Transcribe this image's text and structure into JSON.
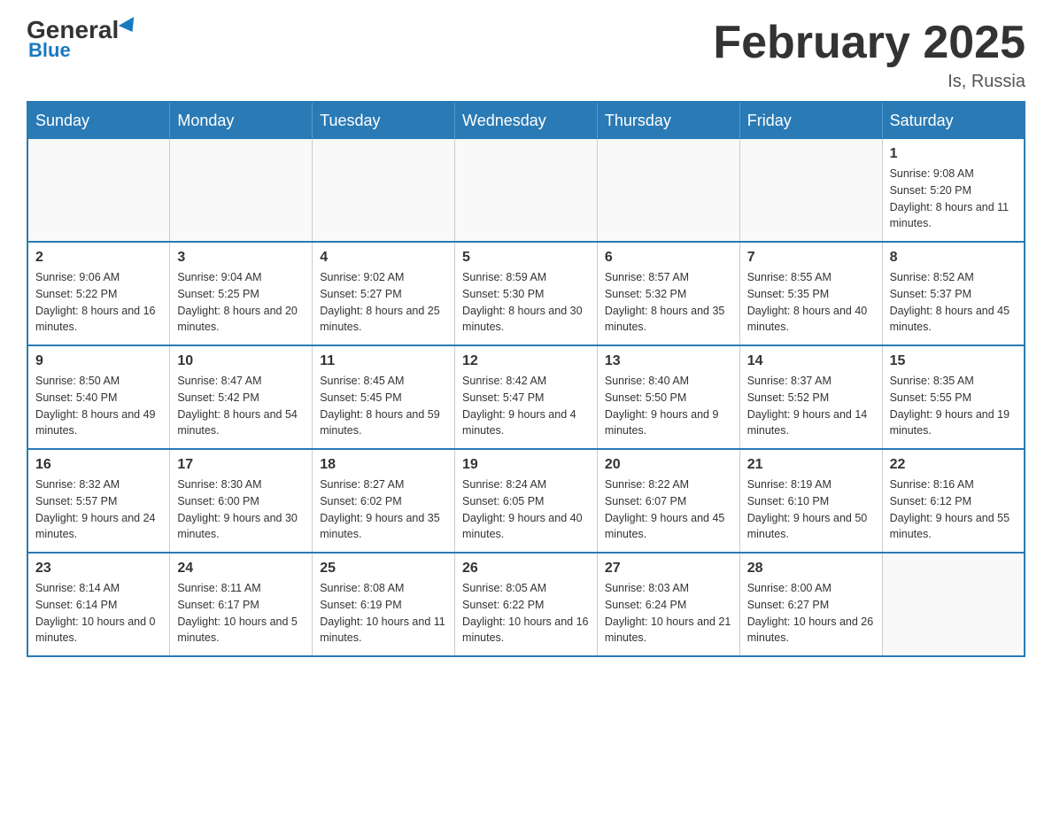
{
  "logo": {
    "general": "General",
    "blue": "Blue"
  },
  "title": "February 2025",
  "location": "Is, Russia",
  "weekdays": [
    "Sunday",
    "Monday",
    "Tuesday",
    "Wednesday",
    "Thursday",
    "Friday",
    "Saturday"
  ],
  "weeks": [
    [
      {
        "day": "",
        "info": ""
      },
      {
        "day": "",
        "info": ""
      },
      {
        "day": "",
        "info": ""
      },
      {
        "day": "",
        "info": ""
      },
      {
        "day": "",
        "info": ""
      },
      {
        "day": "",
        "info": ""
      },
      {
        "day": "1",
        "info": "Sunrise: 9:08 AM\nSunset: 5:20 PM\nDaylight: 8 hours and 11 minutes."
      }
    ],
    [
      {
        "day": "2",
        "info": "Sunrise: 9:06 AM\nSunset: 5:22 PM\nDaylight: 8 hours and 16 minutes."
      },
      {
        "day": "3",
        "info": "Sunrise: 9:04 AM\nSunset: 5:25 PM\nDaylight: 8 hours and 20 minutes."
      },
      {
        "day": "4",
        "info": "Sunrise: 9:02 AM\nSunset: 5:27 PM\nDaylight: 8 hours and 25 minutes."
      },
      {
        "day": "5",
        "info": "Sunrise: 8:59 AM\nSunset: 5:30 PM\nDaylight: 8 hours and 30 minutes."
      },
      {
        "day": "6",
        "info": "Sunrise: 8:57 AM\nSunset: 5:32 PM\nDaylight: 8 hours and 35 minutes."
      },
      {
        "day": "7",
        "info": "Sunrise: 8:55 AM\nSunset: 5:35 PM\nDaylight: 8 hours and 40 minutes."
      },
      {
        "day": "8",
        "info": "Sunrise: 8:52 AM\nSunset: 5:37 PM\nDaylight: 8 hours and 45 minutes."
      }
    ],
    [
      {
        "day": "9",
        "info": "Sunrise: 8:50 AM\nSunset: 5:40 PM\nDaylight: 8 hours and 49 minutes."
      },
      {
        "day": "10",
        "info": "Sunrise: 8:47 AM\nSunset: 5:42 PM\nDaylight: 8 hours and 54 minutes."
      },
      {
        "day": "11",
        "info": "Sunrise: 8:45 AM\nSunset: 5:45 PM\nDaylight: 8 hours and 59 minutes."
      },
      {
        "day": "12",
        "info": "Sunrise: 8:42 AM\nSunset: 5:47 PM\nDaylight: 9 hours and 4 minutes."
      },
      {
        "day": "13",
        "info": "Sunrise: 8:40 AM\nSunset: 5:50 PM\nDaylight: 9 hours and 9 minutes."
      },
      {
        "day": "14",
        "info": "Sunrise: 8:37 AM\nSunset: 5:52 PM\nDaylight: 9 hours and 14 minutes."
      },
      {
        "day": "15",
        "info": "Sunrise: 8:35 AM\nSunset: 5:55 PM\nDaylight: 9 hours and 19 minutes."
      }
    ],
    [
      {
        "day": "16",
        "info": "Sunrise: 8:32 AM\nSunset: 5:57 PM\nDaylight: 9 hours and 24 minutes."
      },
      {
        "day": "17",
        "info": "Sunrise: 8:30 AM\nSunset: 6:00 PM\nDaylight: 9 hours and 30 minutes."
      },
      {
        "day": "18",
        "info": "Sunrise: 8:27 AM\nSunset: 6:02 PM\nDaylight: 9 hours and 35 minutes."
      },
      {
        "day": "19",
        "info": "Sunrise: 8:24 AM\nSunset: 6:05 PM\nDaylight: 9 hours and 40 minutes."
      },
      {
        "day": "20",
        "info": "Sunrise: 8:22 AM\nSunset: 6:07 PM\nDaylight: 9 hours and 45 minutes."
      },
      {
        "day": "21",
        "info": "Sunrise: 8:19 AM\nSunset: 6:10 PM\nDaylight: 9 hours and 50 minutes."
      },
      {
        "day": "22",
        "info": "Sunrise: 8:16 AM\nSunset: 6:12 PM\nDaylight: 9 hours and 55 minutes."
      }
    ],
    [
      {
        "day": "23",
        "info": "Sunrise: 8:14 AM\nSunset: 6:14 PM\nDaylight: 10 hours and 0 minutes."
      },
      {
        "day": "24",
        "info": "Sunrise: 8:11 AM\nSunset: 6:17 PM\nDaylight: 10 hours and 5 minutes."
      },
      {
        "day": "25",
        "info": "Sunrise: 8:08 AM\nSunset: 6:19 PM\nDaylight: 10 hours and 11 minutes."
      },
      {
        "day": "26",
        "info": "Sunrise: 8:05 AM\nSunset: 6:22 PM\nDaylight: 10 hours and 16 minutes."
      },
      {
        "day": "27",
        "info": "Sunrise: 8:03 AM\nSunset: 6:24 PM\nDaylight: 10 hours and 21 minutes."
      },
      {
        "day": "28",
        "info": "Sunrise: 8:00 AM\nSunset: 6:27 PM\nDaylight: 10 hours and 26 minutes."
      },
      {
        "day": "",
        "info": ""
      }
    ]
  ]
}
